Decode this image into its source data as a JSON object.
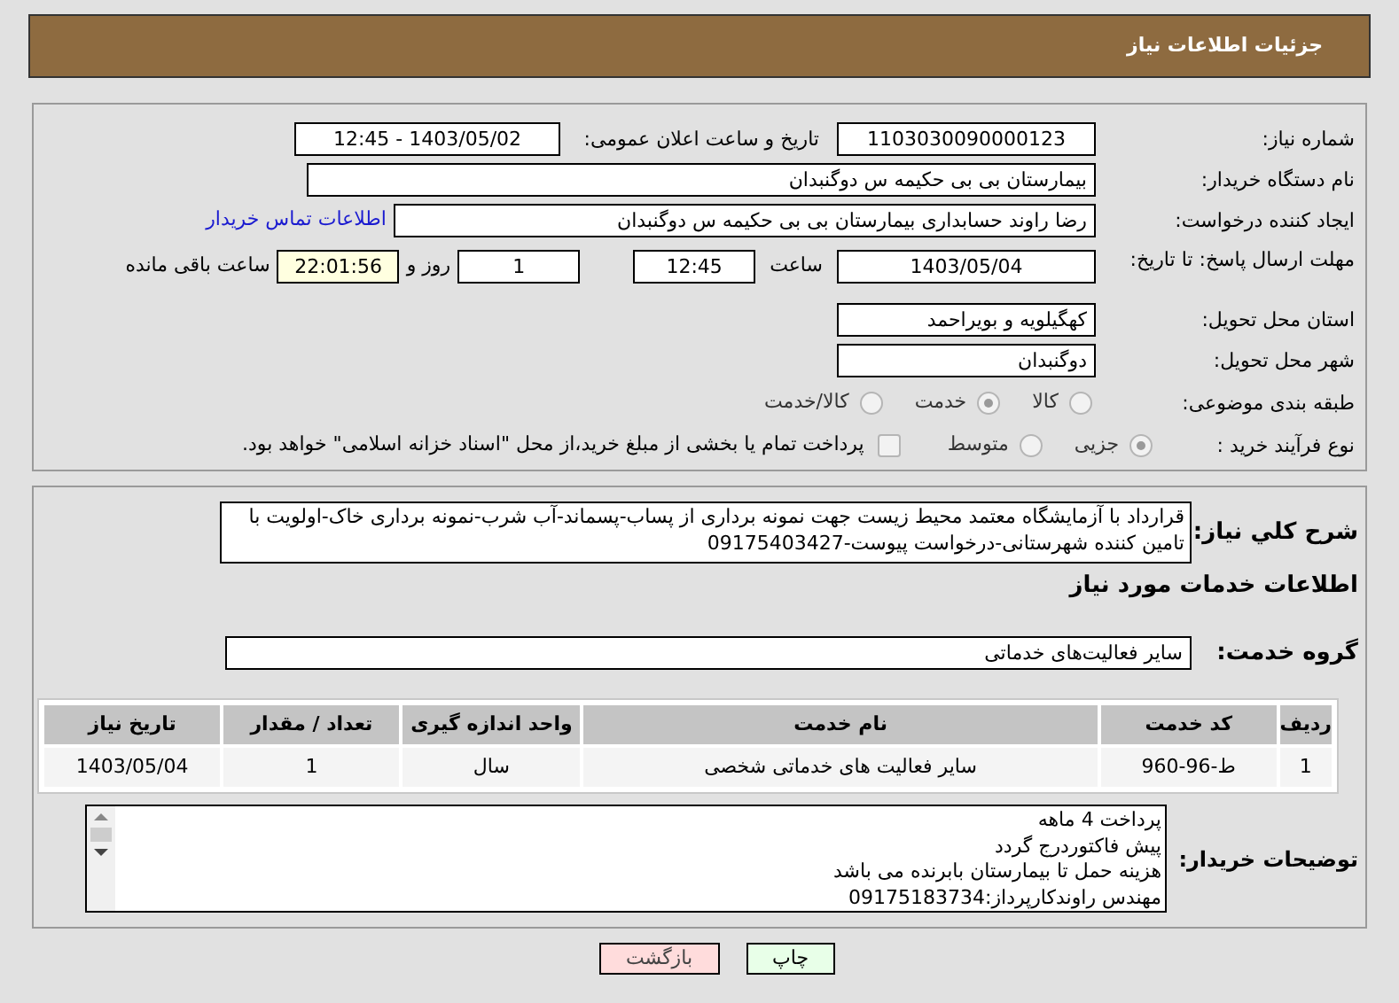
{
  "header": {
    "title": "جزئیات اطلاعات نیاز"
  },
  "need_number": {
    "label": "شماره نیاز:",
    "value": "1103030090000123"
  },
  "announce_datetime": {
    "label": "تاریخ و ساعت اعلان عمومی:",
    "value": "1403/05/02 - 12:45"
  },
  "buyer_org": {
    "label": "نام دستگاه خریدار:",
    "value": "بیمارستان بی بی حکیمه س  دوگنبدان"
  },
  "requester": {
    "label": "ایجاد کننده درخواست:",
    "value": "رضا راوند حسابداری بیمارستان بی بی حکیمه س  دوگنبدان",
    "link": "اطلاعات تماس خریدار"
  },
  "deadline": {
    "label": "مهلت ارسال پاسخ: تا تاریخ:",
    "date": "1403/05/04",
    "time_label": "ساعت",
    "time": "12:45",
    "days": "1",
    "days_label": "روز و",
    "remaining": "22:01:56",
    "remaining_label": "ساعت باقی مانده"
  },
  "province": {
    "label": "استان محل تحویل:",
    "value": "کهگیلویه و بویراحمد"
  },
  "city": {
    "label": "شهر محل تحویل:",
    "value": "دوگنبدان"
  },
  "category": {
    "label": "طبقه بندی موضوعی:",
    "options": [
      {
        "label": "کالا",
        "selected": false
      },
      {
        "label": "خدمت",
        "selected": true
      },
      {
        "label": "کالا/خدمت",
        "selected": false
      }
    ]
  },
  "purchase_process": {
    "label": "نوع فرآیند خرید :",
    "options": [
      {
        "label": "جزیی",
        "selected": true
      },
      {
        "label": "متوسط",
        "selected": false
      }
    ],
    "payment_checkbox": {
      "label": "پرداخت تمام یا بخشی از مبلغ خرید،از محل \"اسناد خزانه اسلامی\" خواهد بود.",
      "checked": false
    }
  },
  "description": {
    "label": "شرح کلي نياز:",
    "text": "قرارداد با آزمایشگاه معتمد محیط زیست جهت نمونه برداری از پساب-پسماند-آب شرب-نمونه برداری خاک-اولویت با تامین کننده شهرستانی-درخواست پیوست-09175403427"
  },
  "services_heading": "اطلاعات خدمات مورد نياز",
  "service_group": {
    "label": "گروه خدمت:",
    "value": "سایر فعالیت‌های خدماتی"
  },
  "table": {
    "columns": [
      "ردیف",
      "کد خدمت",
      "نام خدمت",
      "واحد اندازه گیری",
      "تعداد / مقدار",
      "تاریخ نیاز"
    ],
    "rows": [
      [
        "1",
        "ط-96-960",
        "سایر فعالیت های خدماتی شخصی",
        "سال",
        "1",
        "1403/05/04"
      ]
    ]
  },
  "buyer_notes": {
    "label": "توضیحات خریدار:",
    "lines": [
      "پرداخت 4 ماهه",
      "پیش فاکتوردرج گردد",
      "هزینه حمل تا بیمارستان بابرنده می باشد",
      "مهندس راوندکارپرداز:09175183734"
    ]
  },
  "buttons": [
    {
      "label": "چاپ",
      "kind": "print"
    },
    {
      "label": "بازگشت",
      "kind": "back"
    }
  ]
}
